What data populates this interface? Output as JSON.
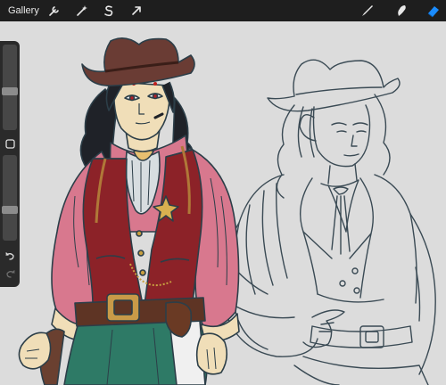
{
  "topbar": {
    "gallery_label": "Gallery"
  },
  "tools_left": [
    {
      "icon": "wrench-icon"
    },
    {
      "icon": "magic-wand-icon"
    },
    {
      "icon": "selection-s-icon"
    },
    {
      "icon": "move-arrow-icon"
    }
  ],
  "tools_right": [
    {
      "icon": "brush-icon"
    },
    {
      "icon": "smudge-icon"
    },
    {
      "icon": "eraser-icon",
      "active_color": "#1a8cff"
    }
  ],
  "sidebar": {
    "brush_size_level": 0.45,
    "opacity_level": 0.35
  },
  "colors": {
    "vest": "#8c2228",
    "shirt": "#d8788e",
    "hat": "#6a3c34",
    "pants": "#2e7a66",
    "skin": "#f0deb8",
    "belt": "#5e3424",
    "lineart": "#2c3e48"
  }
}
